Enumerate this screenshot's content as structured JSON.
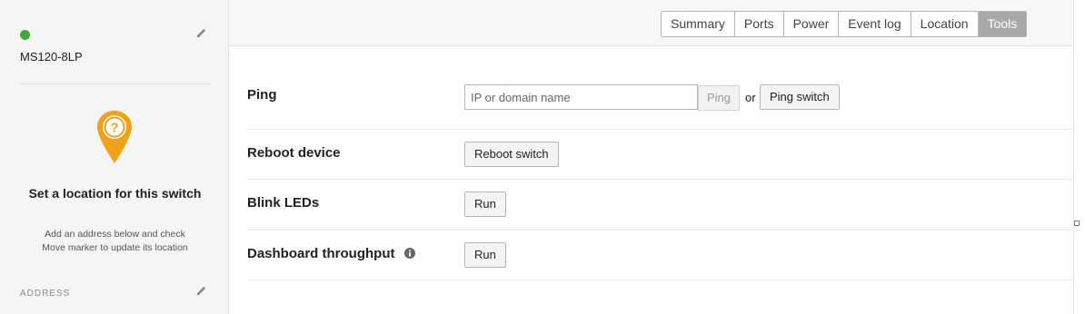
{
  "sidebar": {
    "device_name": "MS120-8LP",
    "status_color": "#43a83c",
    "location_title": "Set a location for this switch",
    "location_help_line1": "Add an address below and check",
    "location_help_line2": "Move marker to update its location",
    "address_label": "ADDRESS",
    "pin_color": "#f0a11a"
  },
  "tabs": [
    {
      "label": "Summary",
      "active": false
    },
    {
      "label": "Ports",
      "active": false
    },
    {
      "label": "Power",
      "active": false
    },
    {
      "label": "Event log",
      "active": false
    },
    {
      "label": "Location",
      "active": false
    },
    {
      "label": "Tools",
      "active": true
    }
  ],
  "tools": {
    "ping": {
      "label": "Ping",
      "input_placeholder": "IP or domain name",
      "input_value": "",
      "ping_button": "Ping",
      "or_text": "or",
      "ping_switch_button": "Ping switch"
    },
    "reboot": {
      "label": "Reboot device",
      "button": "Reboot switch"
    },
    "blink": {
      "label": "Blink LEDs",
      "button": "Run"
    },
    "throughput": {
      "label": "Dashboard throughput",
      "button": "Run",
      "icon": "info-icon"
    }
  }
}
